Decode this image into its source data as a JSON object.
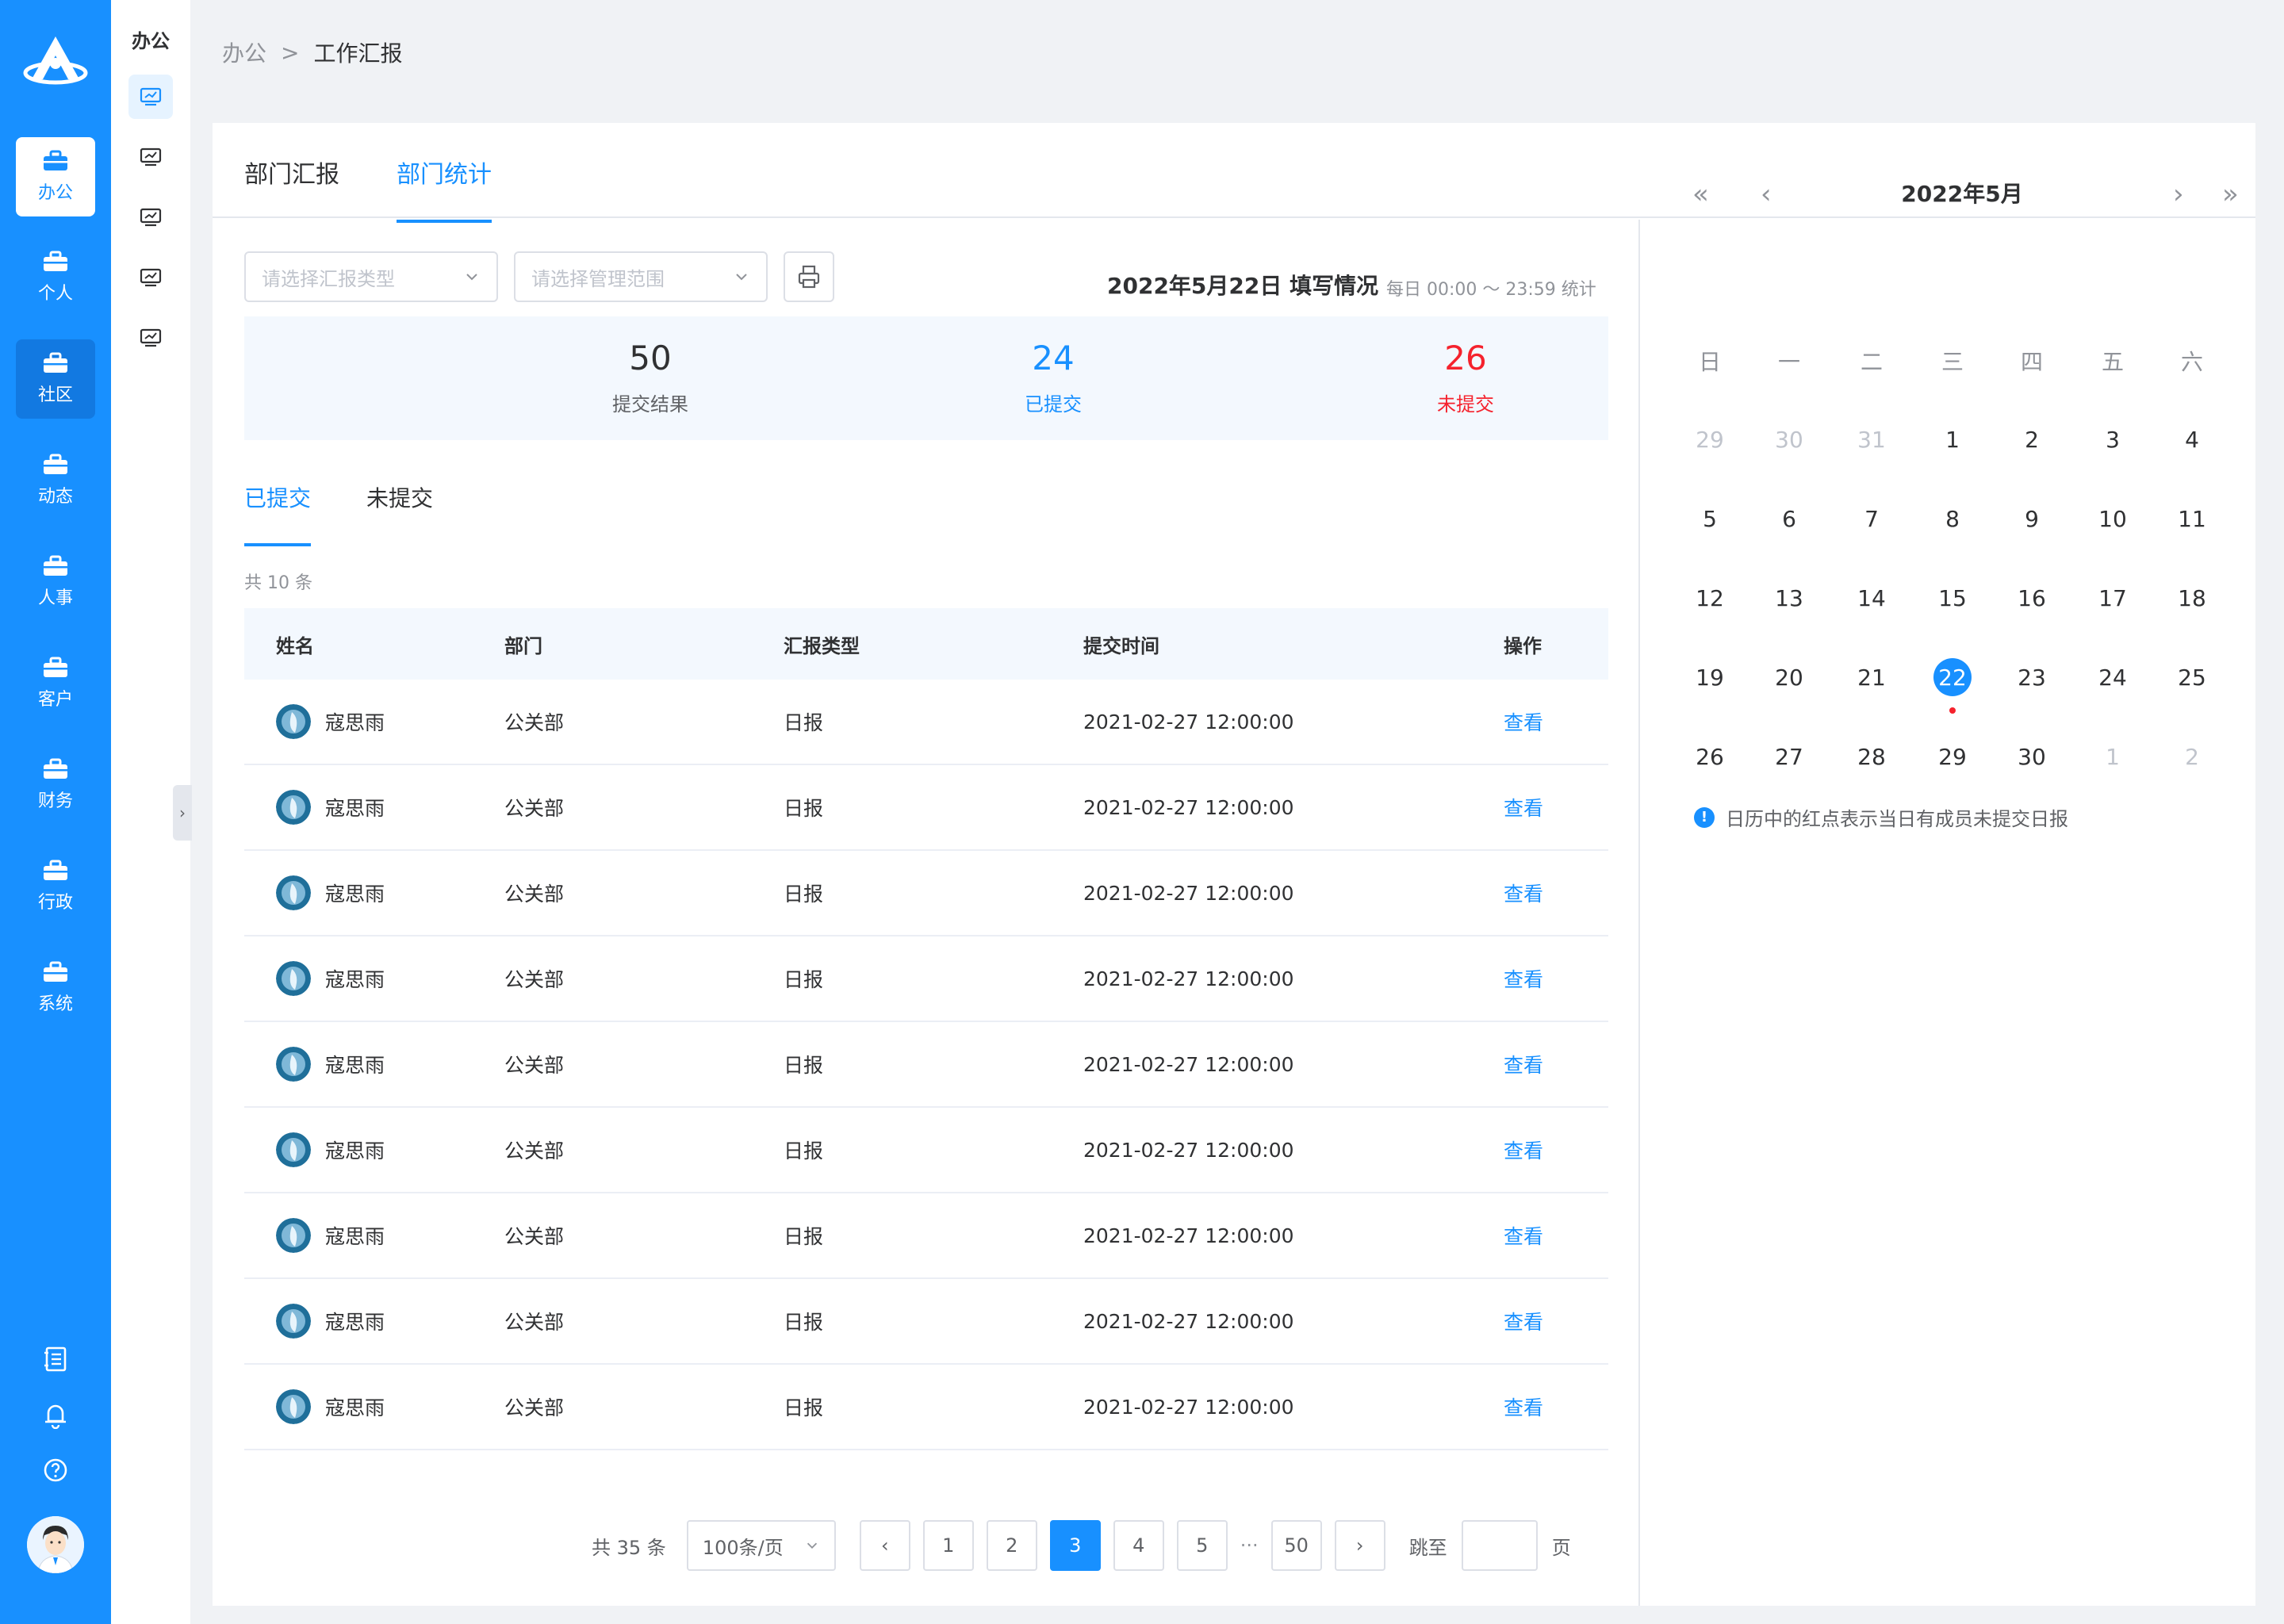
{
  "brand": {
    "logo_icon": "crmeb-logo-icon",
    "primary_color": "#1890ff",
    "danger_color": "#f5222d"
  },
  "nav": {
    "items": [
      {
        "label": "办公",
        "icon": "briefcase-icon",
        "state": "active"
      },
      {
        "label": "个人",
        "icon": "briefcase-icon",
        "state": "normal"
      },
      {
        "label": "社区",
        "icon": "briefcase-icon",
        "state": "hover"
      },
      {
        "label": "动态",
        "icon": "briefcase-icon",
        "state": "normal"
      },
      {
        "label": "人事",
        "icon": "briefcase-icon",
        "state": "normal"
      },
      {
        "label": "客户",
        "icon": "briefcase-icon",
        "state": "normal"
      },
      {
        "label": "财务",
        "icon": "briefcase-icon",
        "state": "normal"
      },
      {
        "label": "行政",
        "icon": "briefcase-icon",
        "state": "normal"
      },
      {
        "label": "系统",
        "icon": "briefcase-icon",
        "state": "normal"
      }
    ],
    "bottom_icons": [
      "notebook-icon",
      "bell-icon",
      "help-icon"
    ]
  },
  "subnav": {
    "title": "办公",
    "icons": [
      "monitor-chart-icon",
      "monitor-chart-icon",
      "monitor-chart-icon",
      "monitor-chart-icon",
      "monitor-chart-icon"
    ]
  },
  "breadcrumb": {
    "parent": "办公",
    "separator": ">",
    "current": "工作汇报"
  },
  "tabs": {
    "report": "部门汇报",
    "stats": "部门统计"
  },
  "filters": {
    "type_placeholder": "请选择汇报类型",
    "scope_placeholder": "请选择管理范围",
    "printer_icon": "printer-icon"
  },
  "fill": {
    "title": "2022年5月22日  填写情况",
    "note": "每日 00:00 ～ 23:59 统计"
  },
  "stats": {
    "total": {
      "value": "50",
      "label": "提交结果"
    },
    "submitted": {
      "value": "24",
      "label": "已提交"
    },
    "unsubmitted": {
      "value": "26",
      "label": "未提交"
    }
  },
  "subtabs": {
    "submitted": "已提交",
    "unsubmitted": "未提交"
  },
  "list_total": "共 10 条",
  "table": {
    "headers": [
      "姓名",
      "部门",
      "汇报类型",
      "提交时间",
      "操作"
    ],
    "rows": [
      {
        "name": "寇思雨",
        "dept": "公关部",
        "type": "日报",
        "time": "2021-02-27 12:00:00",
        "action": "查看"
      },
      {
        "name": "寇思雨",
        "dept": "公关部",
        "type": "日报",
        "time": "2021-02-27 12:00:00",
        "action": "查看"
      },
      {
        "name": "寇思雨",
        "dept": "公关部",
        "type": "日报",
        "time": "2021-02-27 12:00:00",
        "action": "查看"
      },
      {
        "name": "寇思雨",
        "dept": "公关部",
        "type": "日报",
        "time": "2021-02-27 12:00:00",
        "action": "查看"
      },
      {
        "name": "寇思雨",
        "dept": "公关部",
        "type": "日报",
        "time": "2021-02-27 12:00:00",
        "action": "查看"
      },
      {
        "name": "寇思雨",
        "dept": "公关部",
        "type": "日报",
        "time": "2021-02-27 12:00:00",
        "action": "查看"
      },
      {
        "name": "寇思雨",
        "dept": "公关部",
        "type": "日报",
        "time": "2021-02-27 12:00:00",
        "action": "查看"
      },
      {
        "name": "寇思雨",
        "dept": "公关部",
        "type": "日报",
        "time": "2021-02-27 12:00:00",
        "action": "查看"
      },
      {
        "name": "寇思雨",
        "dept": "公关部",
        "type": "日报",
        "time": "2021-02-27 12:00:00",
        "action": "查看"
      }
    ]
  },
  "pagination": {
    "total": "共 35 条",
    "page_size": "100条/页",
    "pages": [
      "1",
      "2",
      "3",
      "4",
      "5"
    ],
    "current": "3",
    "ellipsis": "···",
    "last": "50",
    "jump_label": "跳至",
    "jump_value": "",
    "page_unit": "页"
  },
  "calendar": {
    "title": "2022年5月",
    "weekdays": [
      "日",
      "一",
      "二",
      "三",
      "四",
      "五",
      "六"
    ],
    "weeks": [
      [
        {
          "d": "29",
          "m": true
        },
        {
          "d": "30",
          "m": true
        },
        {
          "d": "31",
          "m": true
        },
        {
          "d": "1"
        },
        {
          "d": "2"
        },
        {
          "d": "3"
        },
        {
          "d": "4"
        }
      ],
      [
        {
          "d": "5"
        },
        {
          "d": "6"
        },
        {
          "d": "7"
        },
        {
          "d": "8"
        },
        {
          "d": "9"
        },
        {
          "d": "10"
        },
        {
          "d": "11"
        }
      ],
      [
        {
          "d": "12"
        },
        {
          "d": "13"
        },
        {
          "d": "14"
        },
        {
          "d": "15"
        },
        {
          "d": "16"
        },
        {
          "d": "17"
        },
        {
          "d": "18"
        }
      ],
      [
        {
          "d": "19"
        },
        {
          "d": "20"
        },
        {
          "d": "21"
        },
        {
          "d": "22",
          "sel": true,
          "dot": true
        },
        {
          "d": "23"
        },
        {
          "d": "24"
        },
        {
          "d": "25"
        }
      ],
      [
        {
          "d": "26"
        },
        {
          "d": "27"
        },
        {
          "d": "28"
        },
        {
          "d": "29"
        },
        {
          "d": "30"
        },
        {
          "d": "1",
          "m": true
        },
        {
          "d": "2",
          "m": true
        }
      ]
    ],
    "tip": "日历中的红点表示当日有成员未提交日报"
  }
}
